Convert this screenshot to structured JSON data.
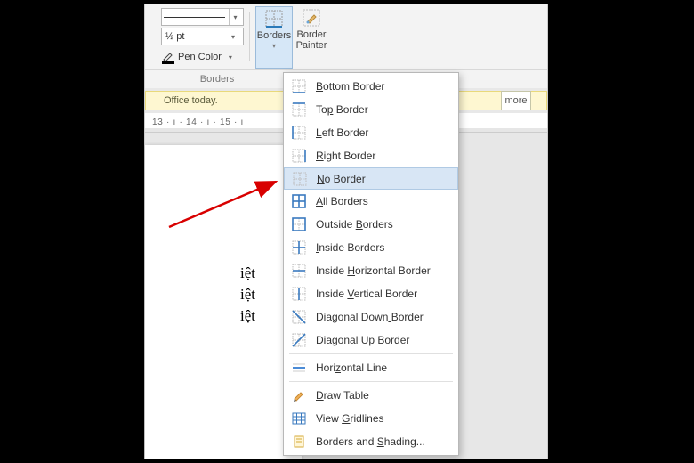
{
  "ribbon": {
    "weight_label": "½ pt",
    "pen_color_label": "Pen Color",
    "group_label": "Borders",
    "borders_btn": "Borders",
    "painter_btn_l1": "Border",
    "painter_btn_l2": "Painter"
  },
  "info_bar": {
    "text": "Office today.",
    "learn_more": "more"
  },
  "ruler": {
    "text": "13 · ı · 14 · ı · 15 · ı"
  },
  "doc": {
    "line1": "iệt",
    "line2": "iệt",
    "line3": "iệt"
  },
  "menu": {
    "items": [
      {
        "label": "Bottom Border",
        "u": 0,
        "icon": "bottom"
      },
      {
        "label": "Top Border",
        "u": 2,
        "icon": "top"
      },
      {
        "label": "Left Border",
        "u": 0,
        "icon": "left"
      },
      {
        "label": "Right Border",
        "u": 0,
        "icon": "right"
      },
      {
        "label": "No Border",
        "u": 0,
        "icon": "none",
        "hl": true
      },
      {
        "label": "All Borders",
        "u": 0,
        "icon": "all"
      },
      {
        "label": "Outside Borders",
        "u": 8,
        "icon": "outside"
      },
      {
        "label": "Inside Borders",
        "u": 0,
        "icon": "inside"
      },
      {
        "label": "Inside Horizontal Border",
        "u": 7,
        "icon": "insideh"
      },
      {
        "label": "Inside Vertical Border",
        "u": 7,
        "icon": "insidev"
      },
      {
        "label": "Diagonal Down Border",
        "u": 13,
        "icon": "diagdown"
      },
      {
        "label": "Diagonal Up Border",
        "u": 9,
        "icon": "diagup"
      },
      {
        "label": "Horizontal Line",
        "u": 4,
        "icon": "hline",
        "sep_before": true
      },
      {
        "label": "Draw Table",
        "u": 0,
        "icon": "draw",
        "sep_before": true
      },
      {
        "label": "View Gridlines",
        "u": 5,
        "icon": "gridlines"
      },
      {
        "label": "Borders and Shading...",
        "u": 12,
        "icon": "shading"
      }
    ]
  }
}
